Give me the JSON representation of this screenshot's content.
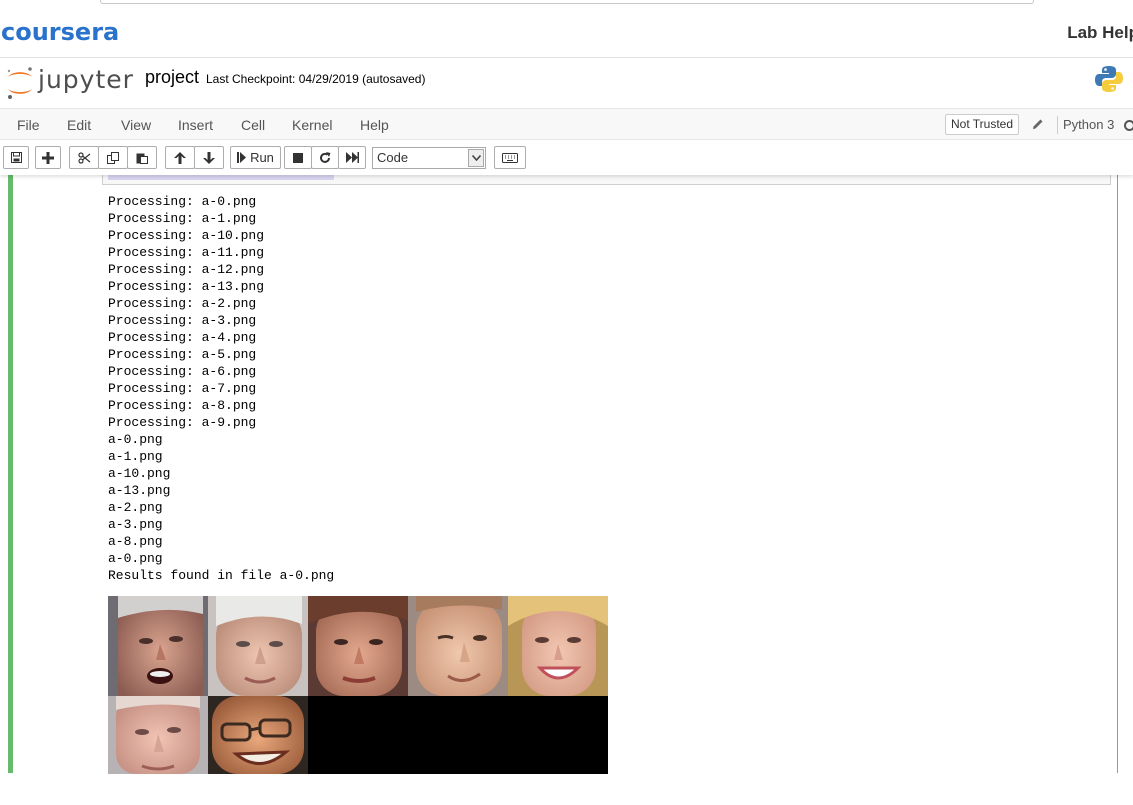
{
  "coursera": {
    "logo_text": "coursera",
    "lab_help": "Lab Help"
  },
  "jupyter": {
    "logo_text": "jupyter",
    "notebook_name": "project",
    "checkpoint": "Last Checkpoint: 04/29/2019  (autosaved)"
  },
  "menu": {
    "items": [
      "File",
      "Edit",
      "View",
      "Insert",
      "Cell",
      "Kernel",
      "Help"
    ],
    "not_trusted": "Not Trusted",
    "kernel": "Python 3"
  },
  "toolbar": {
    "run_label": "Run",
    "cell_type": "Code"
  },
  "output": {
    "lines": [
      "Processing: a-0.png",
      "Processing: a-1.png",
      "Processing: a-10.png",
      "Processing: a-11.png",
      "Processing: a-12.png",
      "Processing: a-13.png",
      "Processing: a-2.png",
      "Processing: a-3.png",
      "Processing: a-4.png",
      "Processing: a-5.png",
      "Processing: a-6.png",
      "Processing: a-7.png",
      "Processing: a-8.png",
      "Processing: a-9.png",
      "a-0.png",
      "a-1.png",
      "a-10.png",
      "a-13.png",
      "a-2.png",
      "a-3.png",
      "a-8.png",
      "a-0.png",
      "Results found in file a-0.png"
    ]
  },
  "colors": {
    "coursera_blue": "#2a73cc",
    "jupyter_orange": "#f37726",
    "cell_green": "#66bb6a"
  }
}
